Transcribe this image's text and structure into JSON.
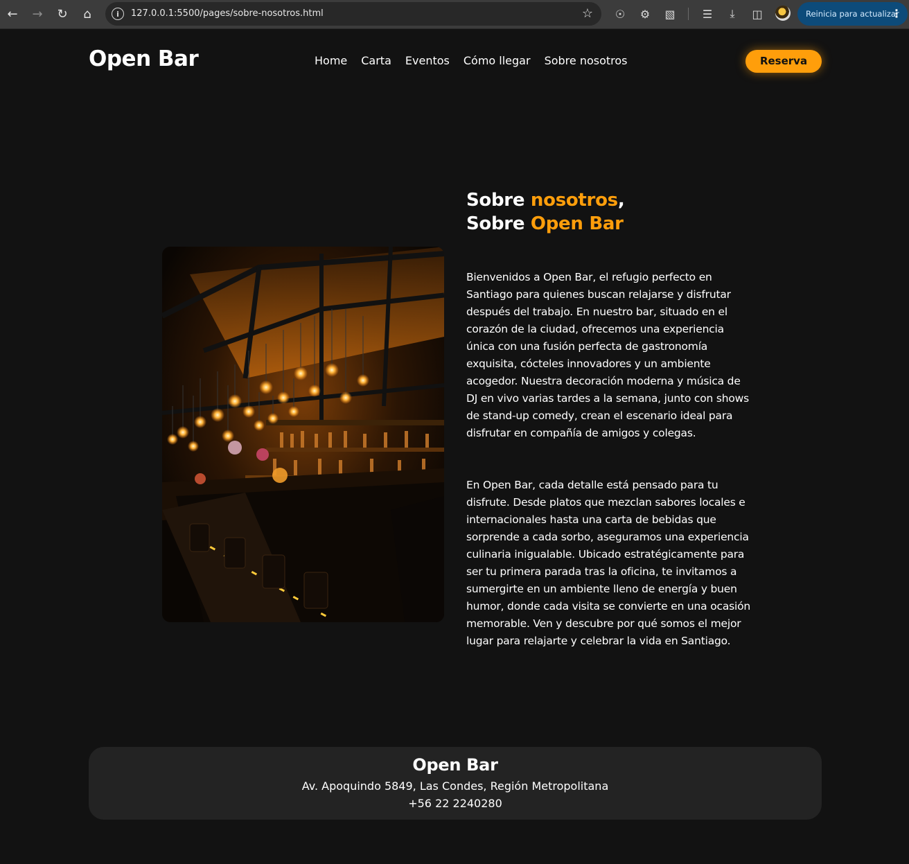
{
  "browser": {
    "url": "127.0.0.1:5500/pages/sobre-nosotros.html",
    "update_label": "Reinicia para actualizar"
  },
  "header": {
    "logo": "Open Bar",
    "nav": [
      "Home",
      "Carta",
      "Eventos",
      "Cómo llegar",
      "Sobre nosotros"
    ],
    "reserve_label": "Reserva"
  },
  "content": {
    "heading_line1_word1": "Sobre ",
    "heading_line1_accent": "nosotros",
    "heading_line1_end": ",",
    "heading_line2_word1": "Sobre ",
    "heading_line2_accent": "Open Bar",
    "paragraph1": "Bienvenidos a Open Bar, el refugio perfecto en Santiago para quienes buscan relajarse y disfrutar después del trabajo. En nuestro bar, situado en el corazón de la ciudad, ofrecemos una experiencia única con una fusión perfecta de gastronomía exquisita, cócteles innovadores y un ambiente acogedor. Nuestra decoración moderna y música de DJ en vivo varias tardes a la semana, junto con shows de stand-up comedy, crean el escenario ideal para disfrutar en compañía de amigos y colegas.",
    "paragraph2": "En Open Bar, cada detalle está pensado para tu disfrute. Desde platos que mezclan sabores locales e internacionales hasta una carta de bebidas que sorprende a cada sorbo, aseguramos una experiencia culinaria inigualable. Ubicado estratégicamente para ser tu primera parada tras la oficina, te invitamos a sumergirte en un ambiente lleno de energía y buen humor, donde cada visita se convierte en una ocasión memorable. Ven y descubre por qué somos el mejor lugar para relajarte y celebrar la vida en Santiago."
  },
  "footer": {
    "title": "Open Bar",
    "address": "Av. Apoquindo 5849, Las Condes, Región Metropolitana",
    "phone": "+56 22 2240280"
  },
  "colors": {
    "accent": "#ff9e0b",
    "background": "#121212",
    "footer_bg": "#232323"
  }
}
